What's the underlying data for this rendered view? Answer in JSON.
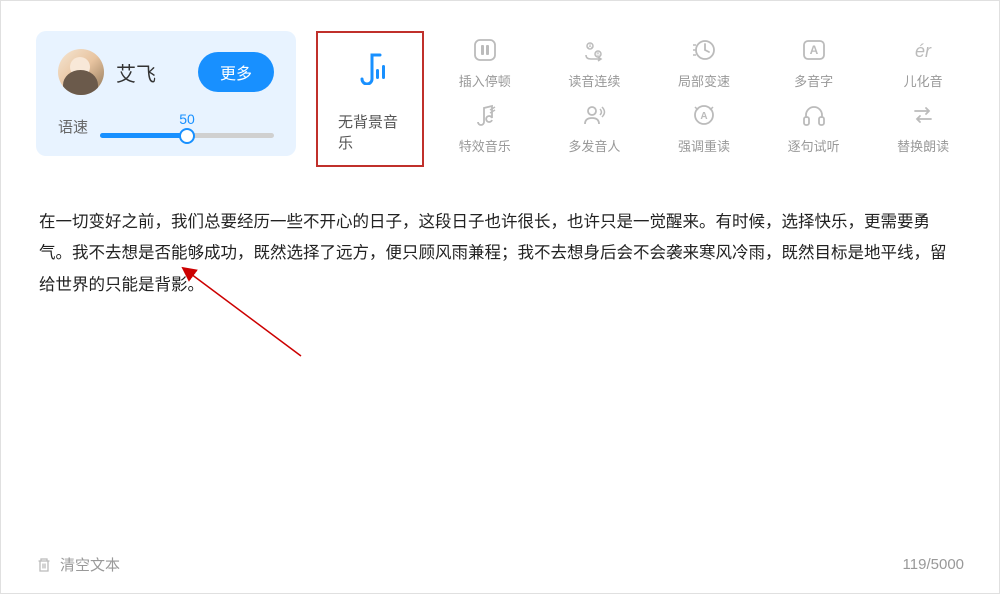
{
  "voice_card": {
    "name": "艾飞",
    "more_btn": "更多",
    "speed_label": "语速",
    "speed_value": "50"
  },
  "bgm_card": {
    "label": "无背景音乐"
  },
  "tools": {
    "row1": [
      {
        "label": "插入停顿",
        "icon": "pause"
      },
      {
        "label": "读音连续",
        "icon": "continuous"
      },
      {
        "label": "局部变速",
        "icon": "speed"
      },
      {
        "label": "多音字",
        "icon": "polyphone"
      },
      {
        "label": "儿化音",
        "icon": "erhua"
      }
    ],
    "row2": [
      {
        "label": "特效音乐",
        "icon": "effect"
      },
      {
        "label": "多发音人",
        "icon": "multivoice"
      },
      {
        "label": "强调重读",
        "icon": "emphasis"
      },
      {
        "label": "逐句试听",
        "icon": "sentence"
      },
      {
        "label": "替换朗读",
        "icon": "replace"
      }
    ]
  },
  "content": "在一切变好之前，我们总要经历一些不开心的日子，这段日子也许很长，也许只是一觉醒来。有时候，选择快乐，更需要勇气。我不去想是否能够成功，既然选择了远方，便只顾风雨兼程；我不去想身后会不会袭来寒风冷雨，既然目标是地平线，留给世界的只能是背影。",
  "bottom": {
    "clear_label": "清空文本",
    "char_count": "119/5000"
  }
}
